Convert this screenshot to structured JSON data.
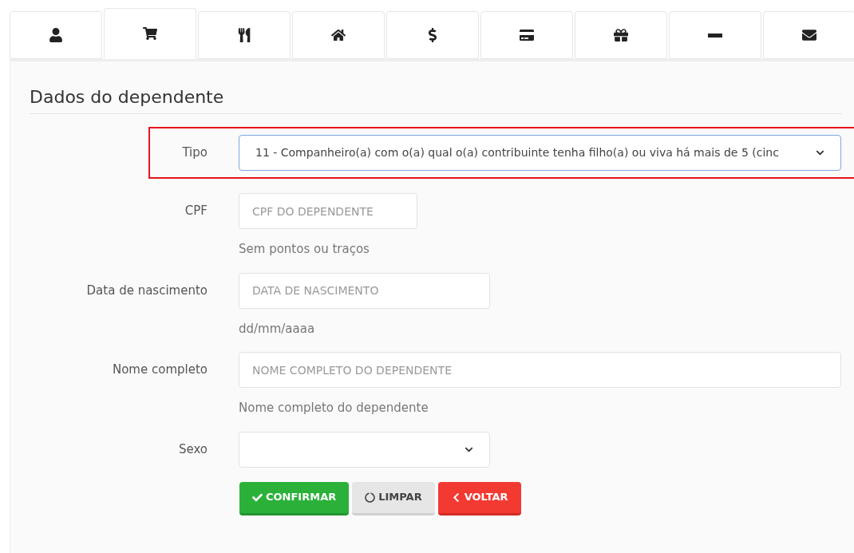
{
  "tabs": [
    {
      "selected": false
    },
    {
      "selected": true
    },
    {
      "selected": false
    },
    {
      "selected": false
    },
    {
      "selected": false
    },
    {
      "selected": false
    },
    {
      "selected": false
    },
    {
      "selected": false
    },
    {
      "selected": false
    }
  ],
  "section_title": "Dados do dependente",
  "fields": [
    {
      "kind": "select",
      "label": "Tipo",
      "value": "11 - Companheiro(a) com o(a) qual o(a) contribuinte tenha filho(a) ou viva há mais de 5 (cinc",
      "highlighted": true
    },
    {
      "kind": "input",
      "label": "CPF",
      "placeholder": "CPF DO DEPENDENTE",
      "hint": "Sem pontos ou traços",
      "highlighted": false
    },
    {
      "kind": "input",
      "label": "Data de nascimento",
      "placeholder": "DATA DE NASCIMENTO",
      "hint": "dd/mm/aaaa",
      "highlighted": false
    },
    {
      "kind": "input",
      "label": "Nome completo",
      "placeholder": "NOME COMPLETO DO DEPENDENTE",
      "hint": "Nome completo do dependente",
      "highlighted": false
    },
    {
      "kind": "select",
      "label": "Sexo",
      "highlighted": false
    }
  ],
  "buttons": [
    {
      "kind": "confirm",
      "label": "CONFIRMAR"
    },
    {
      "kind": "clear",
      "label": "LIMPAR"
    },
    {
      "kind": "back",
      "label": "VOLTAR"
    }
  ]
}
